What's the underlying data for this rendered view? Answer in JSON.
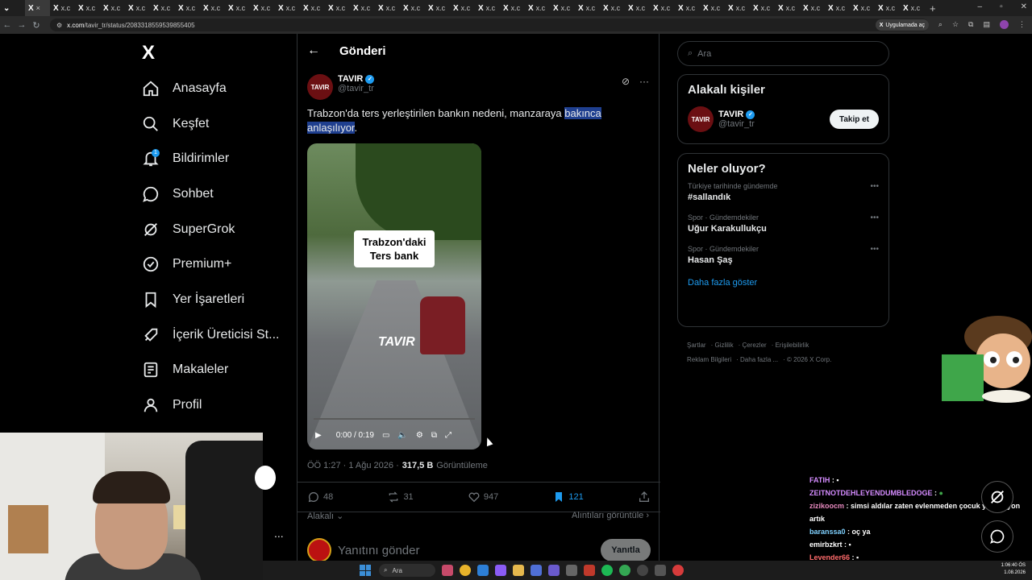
{
  "browser": {
    "tab_label": "x.c",
    "new_tab": "+",
    "url_host": "x.com",
    "url_path": "/tavir_tr/status/2083318559539855405",
    "app_chip": "Uygulamada aç"
  },
  "nav": {
    "logo": "X",
    "items": [
      {
        "label": "Anasayfa",
        "icon": "home-icon"
      },
      {
        "label": "Keşfet",
        "icon": "search-icon"
      },
      {
        "label": "Bildirimler",
        "icon": "bell-icon",
        "badge": "1"
      },
      {
        "label": "Sohbet",
        "icon": "chat-icon"
      },
      {
        "label": "SuperGrok",
        "icon": "grok-icon"
      },
      {
        "label": "Premium+",
        "icon": "verified-icon"
      },
      {
        "label": "Yer İşaretleri",
        "icon": "bookmark-icon"
      },
      {
        "label": "İçerik Üreticisi St...",
        "icon": "rocket-icon"
      },
      {
        "label": "Makaleler",
        "icon": "article-icon"
      },
      {
        "label": "Profil",
        "icon": "person-icon"
      }
    ],
    "more": "..."
  },
  "post": {
    "header_title": "Gönderi",
    "author_name": "TAVIR",
    "author_handle": "@tavir_tr",
    "avatar_text": "TAVIR",
    "text_plain": "Trabzon'da ters yerleştirilen bankın nedeni, manzaraya ",
    "text_highlight": "bakınca anlaşılıyor",
    "text_end": ".",
    "video": {
      "caption_line1": "Trabzon'daki",
      "caption_line2": "Ters bank",
      "brand": "TAVIR",
      "time": "0:00 / 0:19"
    },
    "meta_time": "ÖÖ 1:27 · 1 Ağu 2026 ·",
    "meta_views": "317,5 B",
    "meta_views_label": "Görüntüleme",
    "stats": {
      "replies": "48",
      "reposts": "31",
      "likes": "947",
      "bookmarks": "121"
    },
    "relevance": "Alakalı",
    "quotes": "Alıntıları görüntüle",
    "reply_placeholder": "Yanıtını gönder",
    "reply_button": "Yanıtla"
  },
  "sidebar": {
    "search_placeholder": "Ara",
    "related_title": "Alakalı kişiler",
    "related_name": "TAVIR",
    "related_handle": "@tavir_tr",
    "follow_label": "Takip et",
    "trends_title": "Neler oluyor?",
    "trends": [
      {
        "meta": "Türkiye tarihinde gündemde",
        "name": "#sallandık"
      },
      {
        "meta": "Spor · Gündemdekiler",
        "name": "Uğur Karakullukçu"
      },
      {
        "meta": "Spor · Gündemdekiler",
        "name": "Hasan Şaş"
      }
    ],
    "show_more": "Daha fazla göster",
    "footer": [
      "Şartlar",
      "Gizlilik",
      "Çerezler",
      "Erişilebilirlik",
      "Reklam Bilgileri",
      "Daha fazla ...",
      "© 2026 X Corp."
    ]
  },
  "chat": [
    {
      "user": "FATIH",
      "text": "",
      "color": "#d58cff"
    },
    {
      "user": "ZEITNOTDEHLEYENDUMBLEDOGE",
      "text": "",
      "color": "#d58cff"
    },
    {
      "user": "zizikoocm",
      "text": "simsi aldılar zaten evlenmeden çocuk yapamıyon artık",
      "color": "#e88ac0"
    },
    {
      "user": "baranssa0",
      "text": "oç ya",
      "color": "#7fd1ff"
    },
    {
      "user": "emirbzkrt",
      "text": "",
      "color": "#ffffff"
    },
    {
      "user": "Levender66",
      "text": "",
      "color": "#ff6b6b"
    }
  ],
  "taskbar": {
    "search": "Ara",
    "time": "1:06:40 ÖS",
    "date": "1.08.2026"
  }
}
